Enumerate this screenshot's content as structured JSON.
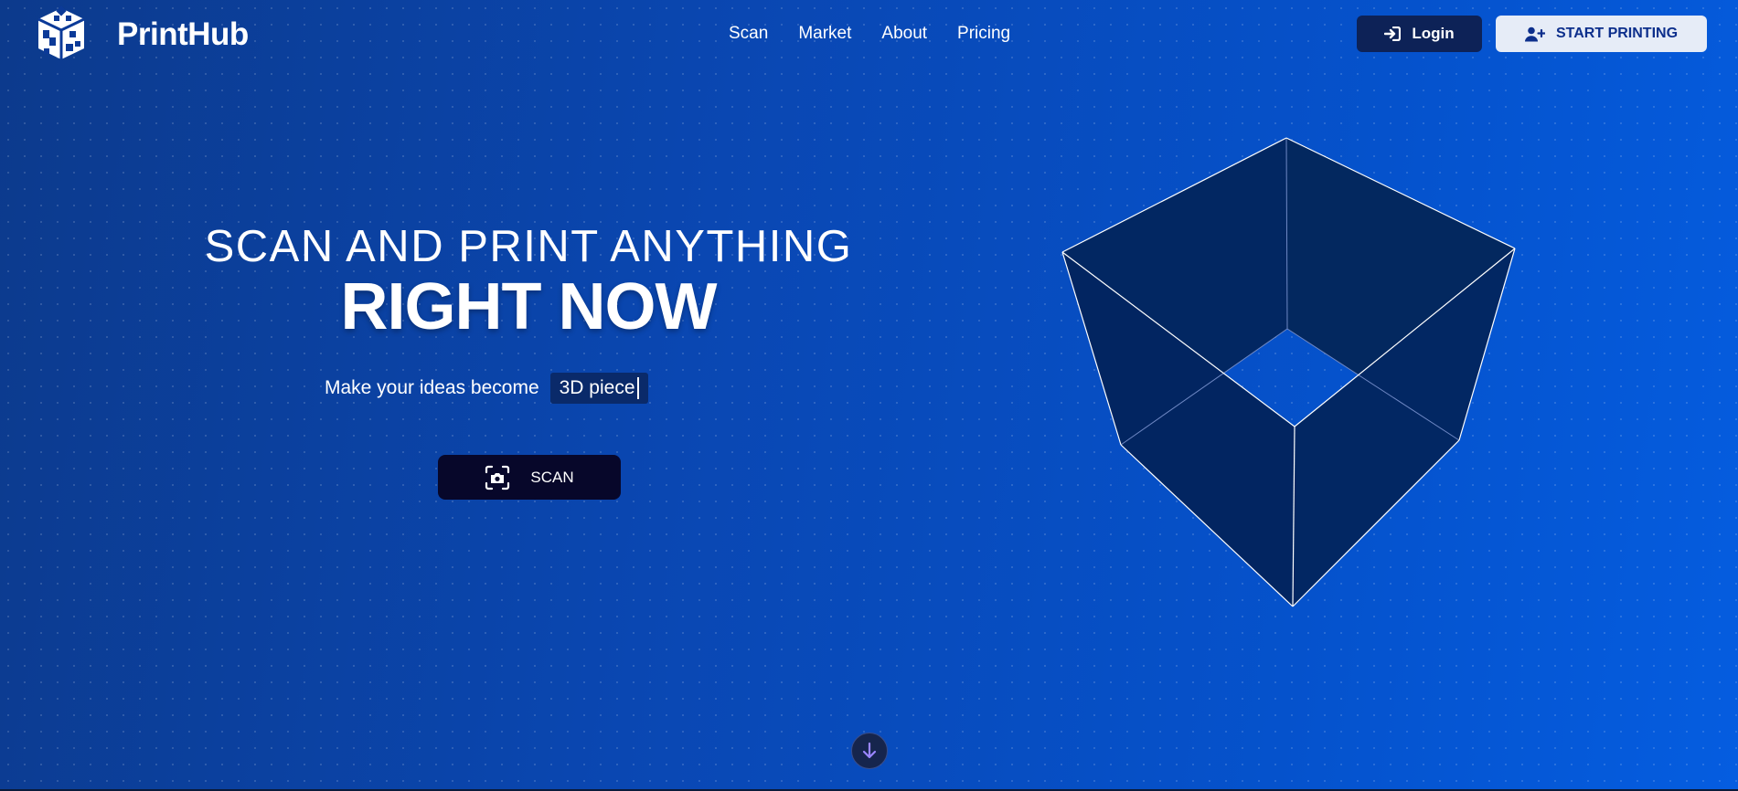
{
  "header": {
    "brand_name": "PrintHub",
    "logo_icon": "printhub-cube-logo-icon",
    "nav": [
      {
        "label": "Scan"
      },
      {
        "label": "Market"
      },
      {
        "label": "About"
      },
      {
        "label": "Pricing"
      }
    ],
    "login_label": "Login",
    "login_icon": "sign-in-icon",
    "start_label": "START PRINTING",
    "start_icon": "user-plus-icon"
  },
  "hero": {
    "line1": "SCAN AND PRINT ANYTHING",
    "line2": "RIGHT NOW",
    "tagline": "Make your ideas become",
    "typed_word": "3D piece",
    "scan_label": "SCAN",
    "scan_icon": "camera-scan-icon"
  },
  "scroll_icon": "arrow-down-icon",
  "colors": {
    "background_start": "#0c3a8c",
    "background_end": "#055de0",
    "login_bg": "#0d2257",
    "start_bg": "#e6ecf7",
    "start_text": "#0d2f8c",
    "scan_bg": "#07072a",
    "cube_face": "#022560",
    "scroll_accent": "#9a86ff"
  }
}
